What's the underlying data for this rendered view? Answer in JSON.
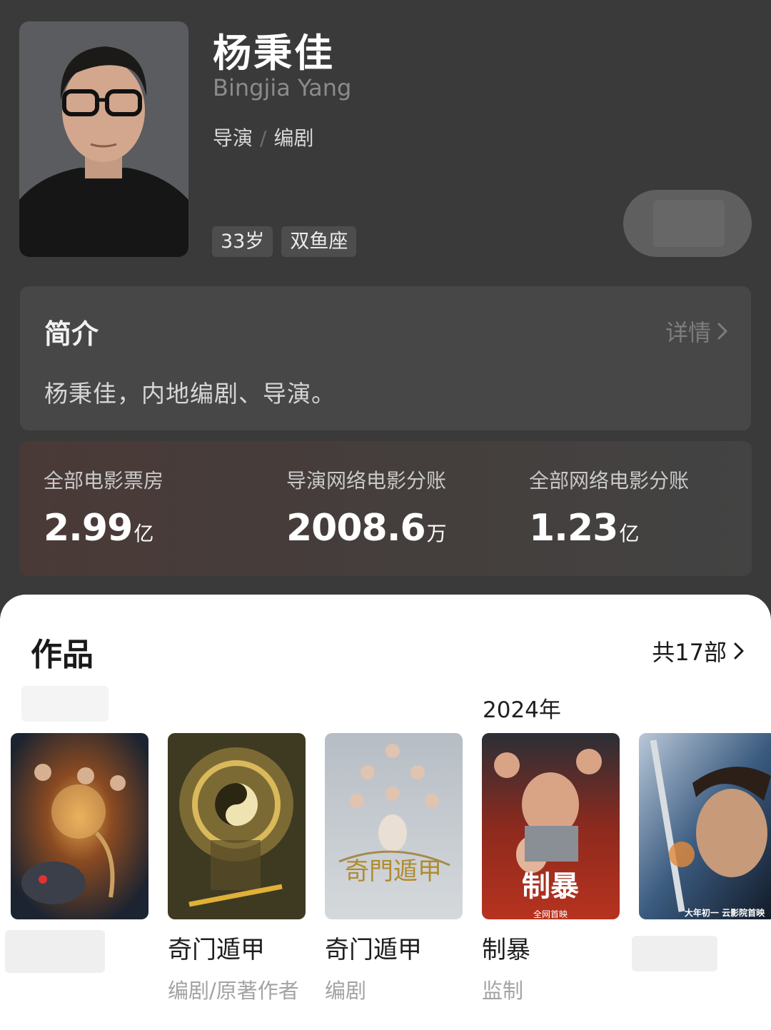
{
  "profile": {
    "name": "杨秉佳",
    "english_name": "Bingjia Yang",
    "roles": [
      "导演",
      "编剧"
    ],
    "role_separator": "/",
    "tags": [
      "33岁",
      "双鱼座"
    ]
  },
  "intro": {
    "title": "简介",
    "more_label": "详情",
    "text": "杨秉佳，内地编剧、导演。"
  },
  "stats": [
    {
      "label": "全部电影票房",
      "value": "2.99",
      "unit": "亿"
    },
    {
      "label": "导演网络电影分账",
      "value": "2008.6",
      "unit": "万"
    },
    {
      "label": "全部网络电影分账",
      "value": "1.23",
      "unit": "亿"
    }
  ],
  "works": {
    "title": "作品",
    "count_label": "共17部",
    "year_label": "2024年",
    "items": [
      {
        "title": "",
        "role": "",
        "poster_icon": "dark-fantasy-poster"
      },
      {
        "title": "奇门遁甲",
        "role": "编剧/原著作者",
        "poster_icon": "bagua-golden-poster"
      },
      {
        "title": "奇门遁甲",
        "role": "编剧",
        "poster_icon": "misty-ensemble-poster"
      },
      {
        "title": "制暴",
        "role": "监制",
        "poster_icon": "red-crime-poster"
      },
      {
        "title": "",
        "role": "",
        "poster_icon": "blue-swordsman-poster"
      }
    ],
    "poster_texts": {
      "poster3_title": "奇門遁甲",
      "poster4_title": "制暴",
      "poster4_bottom": "全网首映",
      "poster5_bottom": "大年初一 云影院首映"
    }
  },
  "colors": {
    "background": "#3a3a3a",
    "card": "#474747",
    "sheet": "#ffffff",
    "muted_text": "#8b8b8b"
  }
}
